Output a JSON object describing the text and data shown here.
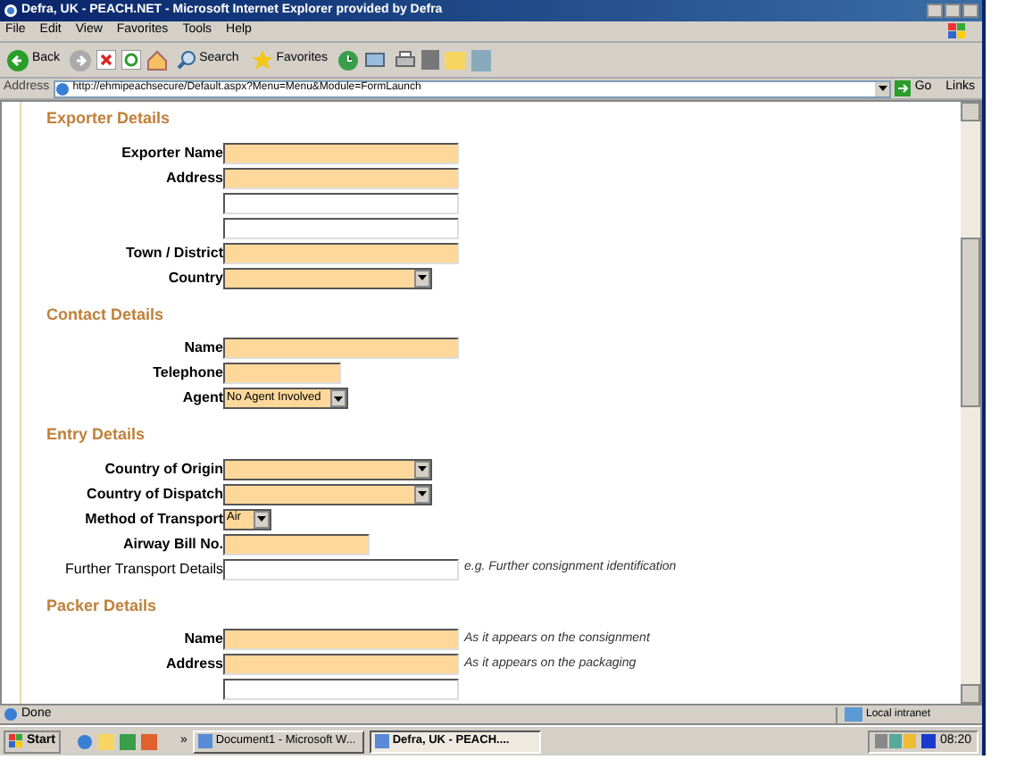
{
  "window": {
    "title": "Defra, UK - PEACH.NET - Microsoft Internet Explorer provided by Defra"
  },
  "menu": [
    "File",
    "Edit",
    "View",
    "Favorites",
    "Tools",
    "Help"
  ],
  "toolbar": {
    "back": "Back",
    "search": "Search",
    "favorites": "Favorites"
  },
  "address_bar": {
    "label": "Address",
    "url": "http://ehmipeachsecure/Default.aspx?Menu=Menu&Module=FormLaunch",
    "go": "Go",
    "links": "Links"
  },
  "sections": [
    {
      "title": "Exporter Details",
      "fields": [
        {
          "label": "Exporter Name",
          "kind": "field",
          "required": true
        },
        {
          "label": "Address",
          "kind": "field",
          "required": true
        },
        {
          "kind": "field",
          "required": false
        },
        {
          "kind": "field",
          "required": false
        },
        {
          "label": "Town / District",
          "kind": "field",
          "required": true
        },
        {
          "label": "Country",
          "kind": "dropdown",
          "required": true
        }
      ]
    },
    {
      "title": "Contact Details",
      "fields": [
        {
          "label": "Name",
          "kind": "field",
          "required": true
        },
        {
          "label": "Telephone",
          "kind": "shortfield",
          "required": true
        },
        {
          "label": "Agent",
          "kind": "shortdropdown",
          "required": true,
          "value": "No Agent Involved"
        }
      ]
    },
    {
      "title": "Entry Details",
      "fields": [
        {
          "label": "Country of Origin",
          "kind": "dropdown",
          "required": true
        },
        {
          "label": "Country of Dispatch",
          "kind": "dropdown",
          "required": true
        },
        {
          "label": "Method of Transport",
          "kind": "tinydropdown",
          "required": true,
          "value": "Air"
        },
        {
          "label": "Airway Bill No.",
          "kind": "midfield",
          "required": true
        },
        {
          "label": "Further Transport Details",
          "kind": "field",
          "required": false,
          "hint": "e.g. Further consignment identification"
        }
      ]
    },
    {
      "title": "Packer Details",
      "fields": [
        {
          "label": "Name",
          "kind": "field",
          "required": true,
          "hint": "As it appears on the consignment"
        },
        {
          "label": "Address",
          "kind": "field",
          "required": true,
          "hint": "As it appears on the packaging"
        },
        {
          "kind": "field",
          "required": false
        }
      ]
    }
  ],
  "status_bar": {
    "text": "Done",
    "zone": "Local intranet"
  },
  "taskbar": {
    "start": "Start",
    "chevron": "»",
    "tasks": [
      {
        "label": "Document1 - Microsoft W...",
        "selected": false
      },
      {
        "label": "Defra, UK - PEACH....",
        "selected": true
      }
    ],
    "clock": "08:20"
  }
}
